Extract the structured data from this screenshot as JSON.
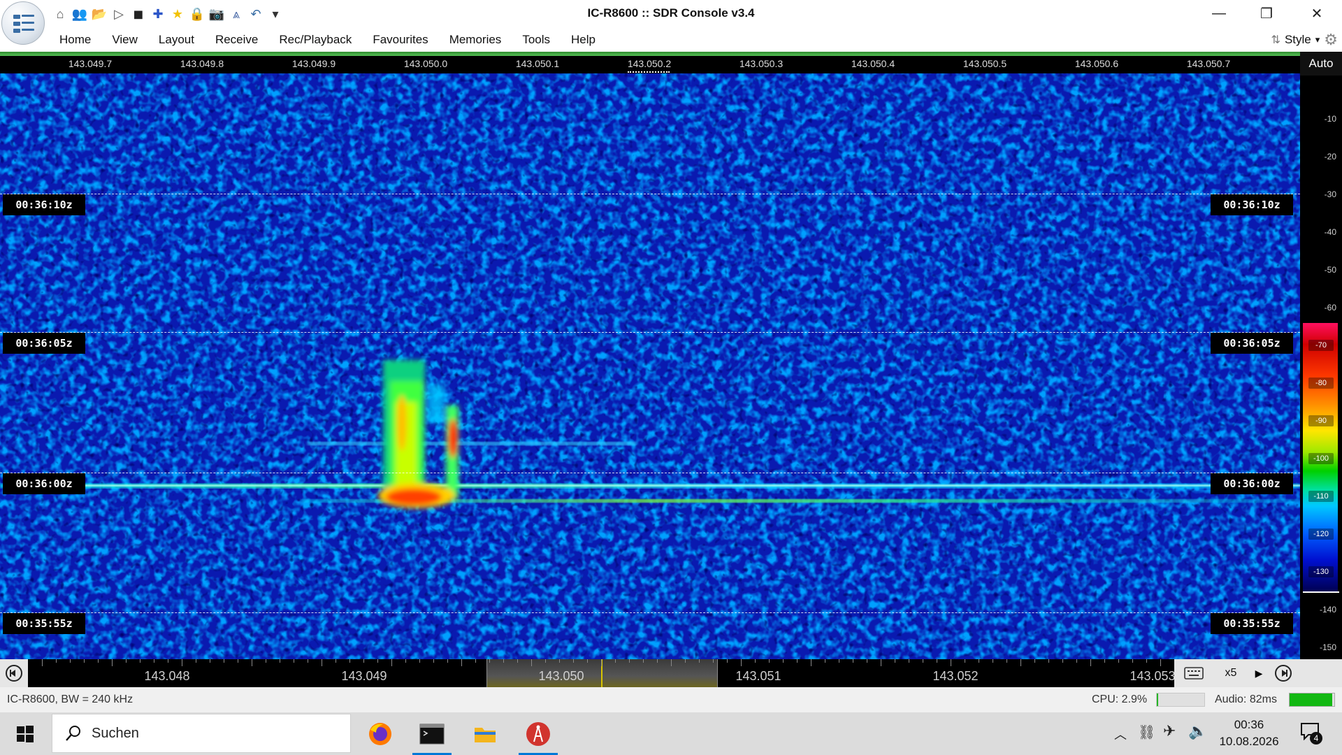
{
  "window": {
    "title": "IC-R8600 :: SDR Console v3.4",
    "minimize_glyph": "—",
    "restore_glyph": "❐",
    "close_glyph": "✕"
  },
  "quick_access": [
    {
      "icon": "home-icon",
      "glyph": "⌂"
    },
    {
      "icon": "users-icon",
      "glyph": "👥"
    },
    {
      "icon": "folder-icon",
      "glyph": "📂"
    },
    {
      "icon": "play-icon",
      "glyph": "▷"
    },
    {
      "icon": "stop-icon",
      "glyph": "◼"
    },
    {
      "icon": "add-circle-icon",
      "glyph": "✚"
    },
    {
      "icon": "star-icon",
      "glyph": "★"
    },
    {
      "icon": "lock-icon",
      "glyph": "🔒"
    },
    {
      "icon": "camera-icon",
      "glyph": "📷"
    },
    {
      "icon": "antenna-icon",
      "glyph": "⩓"
    },
    {
      "icon": "undo-icon",
      "glyph": "↶"
    },
    {
      "icon": "customize-dropdown-icon",
      "glyph": "▾"
    }
  ],
  "menu": [
    "Home",
    "View",
    "Layout",
    "Receive",
    "Rec/Playback",
    "Favourites",
    "Memories",
    "Tools",
    "Help"
  ],
  "style_menu": {
    "label": "Style",
    "arrow": "▾"
  },
  "freq_ruler": {
    "labels": [
      "143.049.7",
      "143.049.8",
      "143.049.9",
      "143.050.0",
      "143.050.1",
      "143.050.2",
      "143.050.3",
      "143.050.4",
      "143.050.5",
      "143.050.6",
      "143.050.7"
    ]
  },
  "waterfall": {
    "time_labels": [
      "00:36:10z",
      "00:36:05z",
      "00:36:00z",
      "00:35:55z"
    ]
  },
  "scale": {
    "auto_label": "Auto",
    "values": [
      "-10",
      "-20",
      "-30",
      "-40",
      "-50",
      "-60",
      "-70",
      "-80",
      "-90",
      "-100",
      "-110",
      "-120",
      "-130",
      "-140",
      "-150"
    ]
  },
  "band": {
    "labels": [
      "143.048",
      "143.049",
      "143.050",
      "143.051",
      "143.052",
      "143.053"
    ],
    "zoom_label": "x5"
  },
  "status": {
    "device_info": "IC-R8600, BW = 240 kHz",
    "cpu": "CPU: 2.9%",
    "cpu_level": 0.029,
    "audio": "Audio: 82ms",
    "audio_level": 0.95
  },
  "taskbar": {
    "search_placeholder": "Suchen",
    "time": "00:36",
    "date": "10.08.2026",
    "notification_count": "4"
  },
  "colors": {
    "waterfall_background": "#0a1ab0",
    "signal_core": "#ff2000",
    "accent_blue": "#0078d7"
  }
}
